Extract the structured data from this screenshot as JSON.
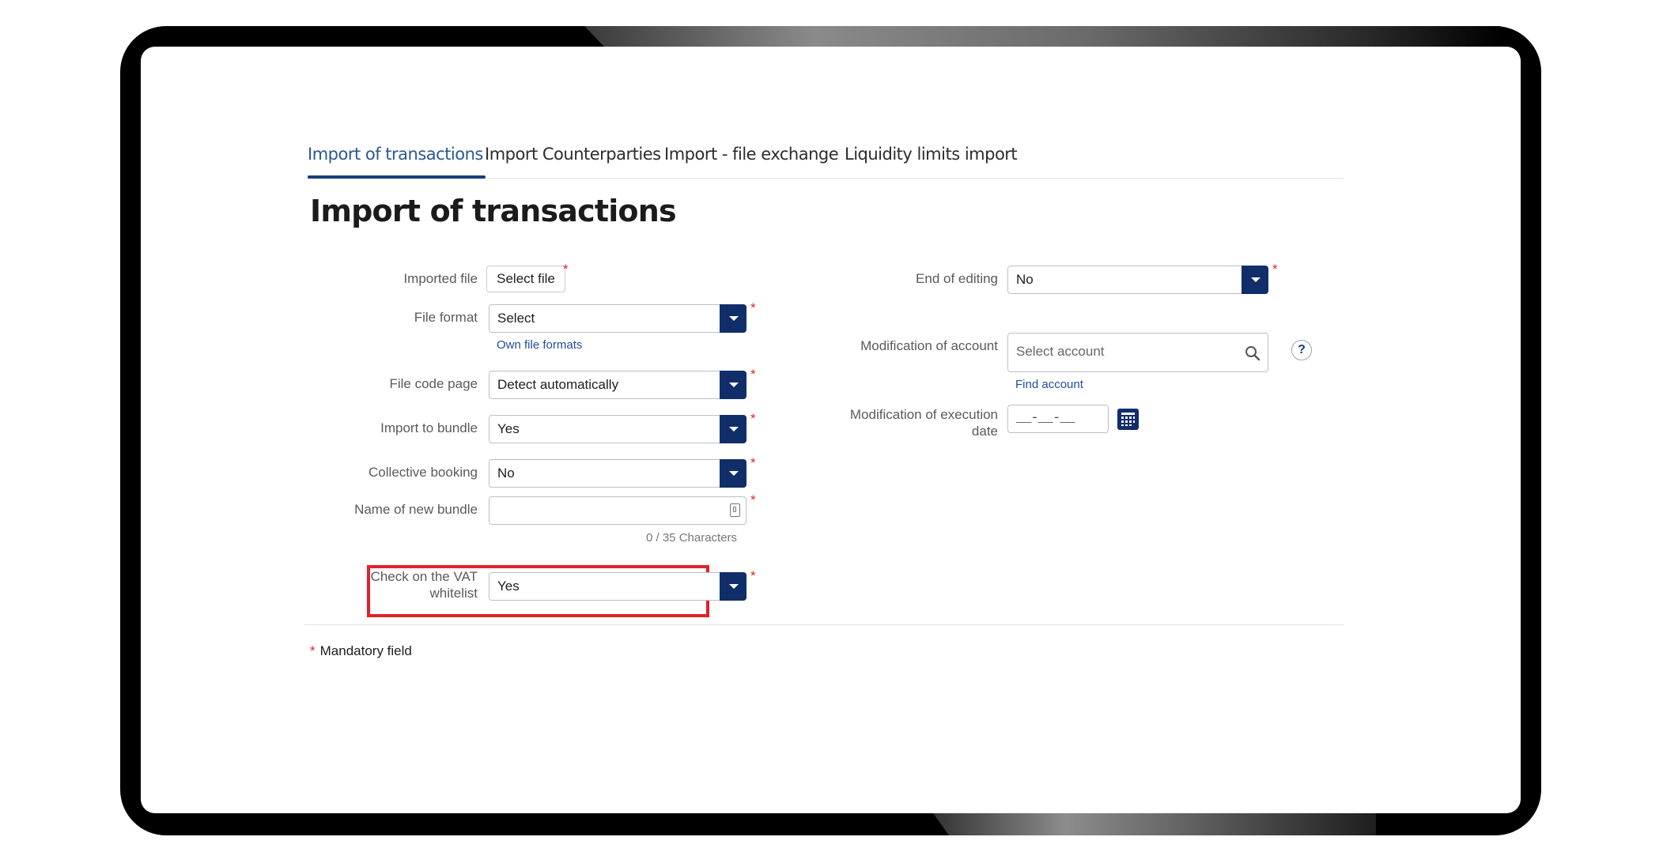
{
  "tabs": [
    {
      "label": "Import of transactions",
      "active": true
    },
    {
      "label": "Import Counterparties",
      "active": false
    },
    {
      "label": "Import - file exchange",
      "active": false
    },
    {
      "label": "Liquidity limits import",
      "active": false
    }
  ],
  "page_title": "Import of transactions",
  "left_form": {
    "imported_file": {
      "label": "Imported file",
      "button": "Select file"
    },
    "file_format": {
      "label": "File format",
      "value": "Select",
      "link": "Own file formats"
    },
    "file_code_page": {
      "label": "File code page",
      "value": "Detect automatically"
    },
    "import_to_bundle": {
      "label": "Import to bundle",
      "value": "Yes"
    },
    "collective_booking": {
      "label": "Collective booking",
      "value": "No"
    },
    "name_of_new_bundle": {
      "label": "Name of new bundle",
      "value": "",
      "counter": "0 / 35 Characters"
    },
    "vat_whitelist": {
      "label_line1": "Check on the VAT",
      "label_line2": "whitelist",
      "value": "Yes"
    }
  },
  "right_form": {
    "end_of_editing": {
      "label": "End of editing",
      "value": "No"
    },
    "modification_of_account": {
      "label": "Modification of account",
      "placeholder": "Select account",
      "link": "Find account",
      "help": "?"
    },
    "modification_of_execution_date": {
      "label_line1": "Modification of execution",
      "label_line2": "date",
      "mask": "__-__-__"
    }
  },
  "required_marker": "*",
  "mandatory_note": "Mandatory field",
  "icons": [
    "search-icon",
    "calendar-icon",
    "help-icon",
    "dropdown-arrow-icon",
    "text-edit-icon"
  ],
  "colors": {
    "accent": "#102e69",
    "active_tab": "#2b5797",
    "required": "#e1252d",
    "highlight": "#e0222b",
    "link": "#1e4e9a"
  }
}
